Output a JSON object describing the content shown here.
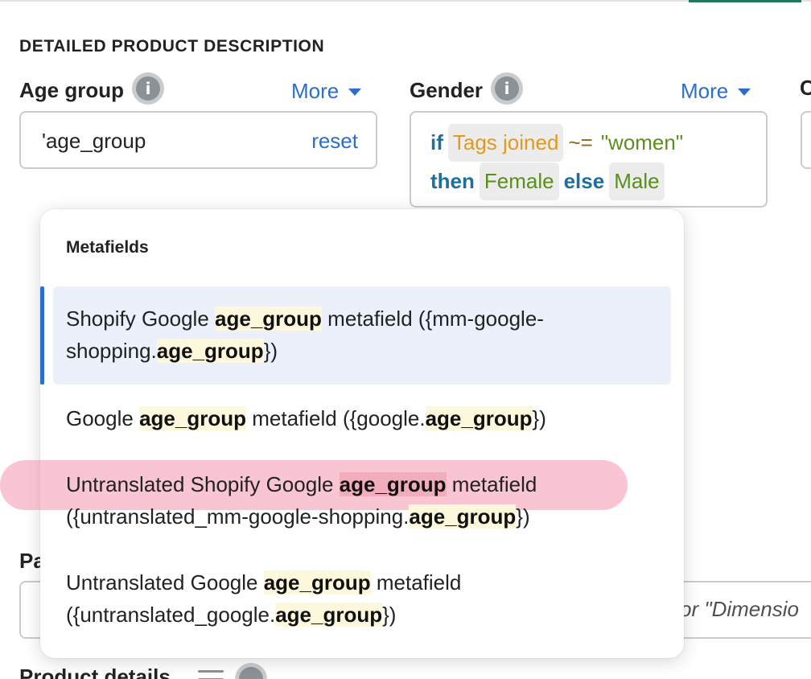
{
  "section": {
    "title": "DETAILED PRODUCT DESCRIPTION"
  },
  "age_group": {
    "label": "Age group",
    "info_icon": "info-icon",
    "more_label": "More",
    "value": "'age_group",
    "reset_label": "reset"
  },
  "gender": {
    "label": "Gender",
    "info_icon": "info-icon",
    "more_label": "More",
    "expr": {
      "if": "if",
      "tags_chip": "Tags joined",
      "op": "~=",
      "string": "\"women\"",
      "then": "then",
      "female_chip": "Female",
      "else": "else",
      "male_chip": "Male"
    }
  },
  "cut_off": {
    "label_fragment": "C",
    "pa_fragment": "Pa",
    "pa_right_text": "or \"Dimensio",
    "product_details": "Product details"
  },
  "dropdown": {
    "heading": "Metafields",
    "items": [
      {
        "p1": "Shopify Google ",
        "b1": "age_group",
        "p2": " metafield ({mm-google-",
        "p3": "shopping.",
        "b2": "age_group",
        "p4": "})"
      },
      {
        "p1": "Google ",
        "b1": "age_group",
        "p2": " metafield ({google.",
        "b2": "age_group",
        "p3": "})"
      },
      {
        "p1": "Untranslated Shopify Google ",
        "b1": "age_group",
        "p2": " metafield",
        "p3": "({untranslated_mm-google-shopping.",
        "b2": "age_group",
        "p4": "})"
      },
      {
        "p1": "Untranslated Google ",
        "b1": "age_group",
        "p2": " metafield",
        "p3": "({untranslated_google.",
        "b2": "age_group",
        "p4": "})"
      }
    ]
  },
  "colors": {
    "link_blue": "#2c6ecb",
    "keyword_blue": "#1f6f9a",
    "chip_orange": "#e09b1c",
    "chip_green": "#5a8f19",
    "selection_bg": "#ebf0fa",
    "annotation_pink": "#f496af"
  }
}
